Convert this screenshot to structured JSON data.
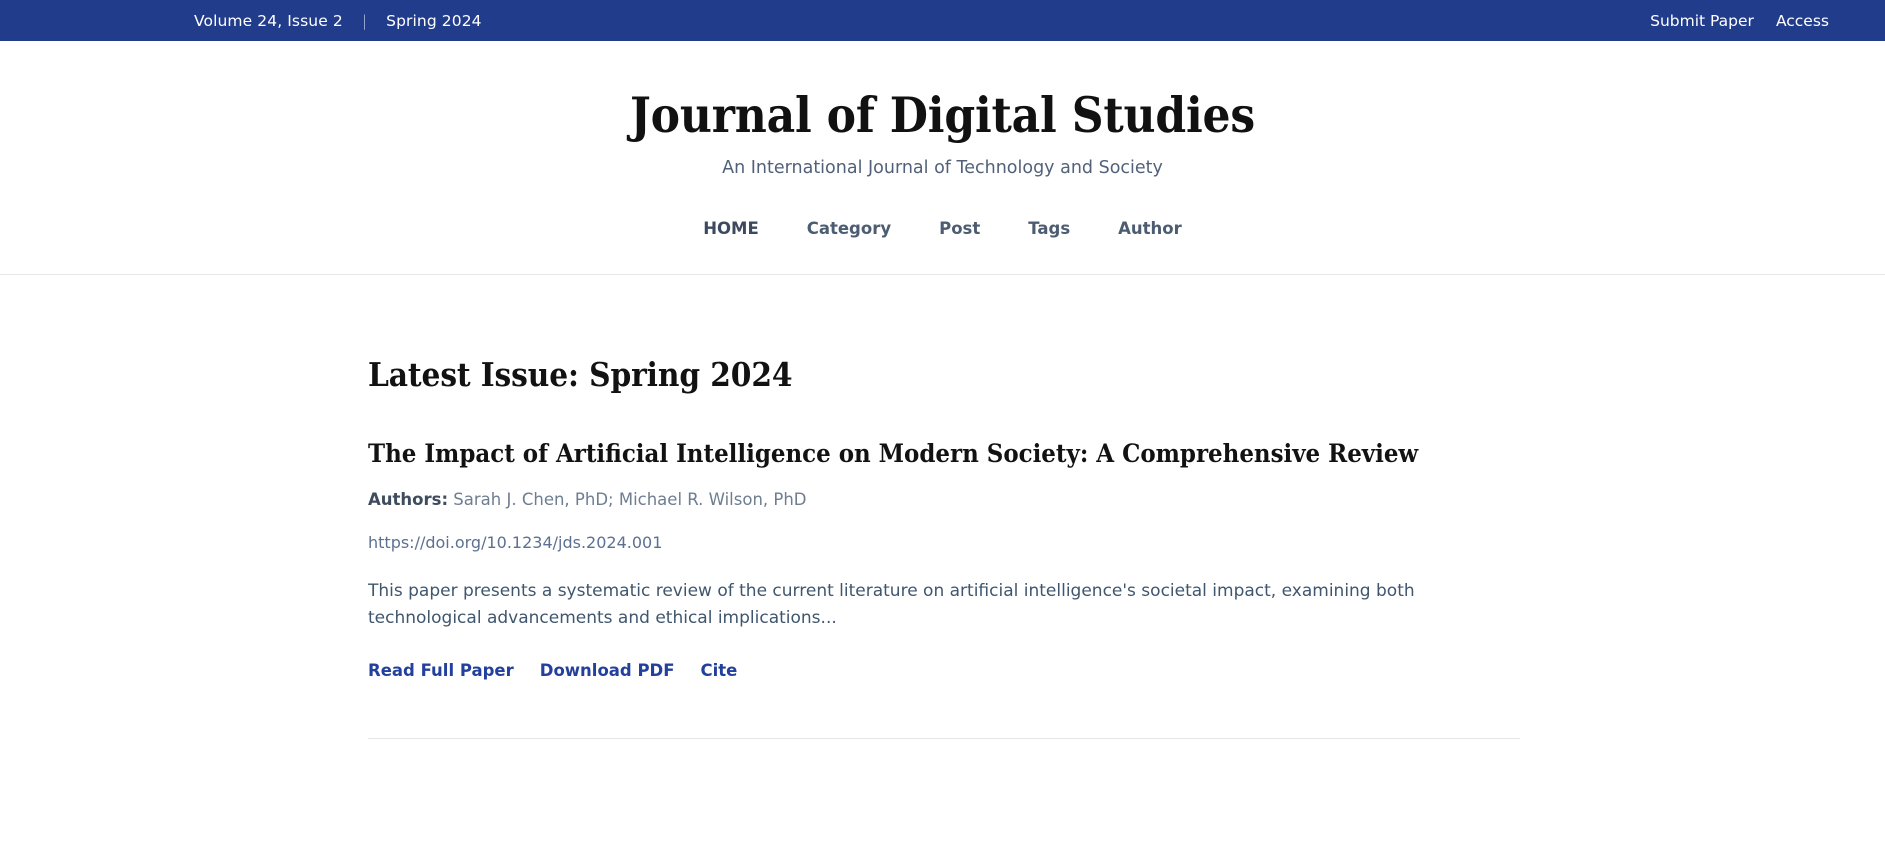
{
  "topbar": {
    "volume": "Volume 24, Issue 2",
    "separator": "|",
    "season": "Spring 2024",
    "links": [
      {
        "label": "Submit Paper",
        "name": "submit-paper"
      },
      {
        "label": "Access",
        "name": "access"
      }
    ]
  },
  "masthead": {
    "title": "Journal of Digital Studies",
    "subtitle": "An International Journal of Technology and Society",
    "nav": [
      {
        "label": "HOME",
        "active": true
      },
      {
        "label": "Category",
        "active": false
      },
      {
        "label": "Post",
        "active": false
      },
      {
        "label": "Tags",
        "active": false
      },
      {
        "label": "Author",
        "active": false
      }
    ]
  },
  "main": {
    "section_heading": "Latest Issue: Spring 2024",
    "article": {
      "title": "The Impact of Artificial Intelligence on Modern Society: A Comprehensive Review",
      "authors_label": "Authors:",
      "authors_value": "Sarah J. Chen, PhD; Michael R. Wilson, PhD",
      "doi": "https://doi.org/10.1234/jds.2024.001",
      "abstract": "This paper presents a systematic review of the current literature on artificial intelligence's societal impact, examining both technological advancements and ethical implications...",
      "actions": [
        {
          "label": "Read Full Paper",
          "name": "read-full-paper"
        },
        {
          "label": "Download PDF",
          "name": "download-pdf"
        },
        {
          "label": "Cite",
          "name": "cite"
        }
      ]
    }
  },
  "colors": {
    "brand_navy": "#223c8c",
    "link_blue": "#22409c",
    "nav_text": "#4c5c72",
    "body_text": "#3f566e",
    "rule": "#e4e4e6"
  }
}
